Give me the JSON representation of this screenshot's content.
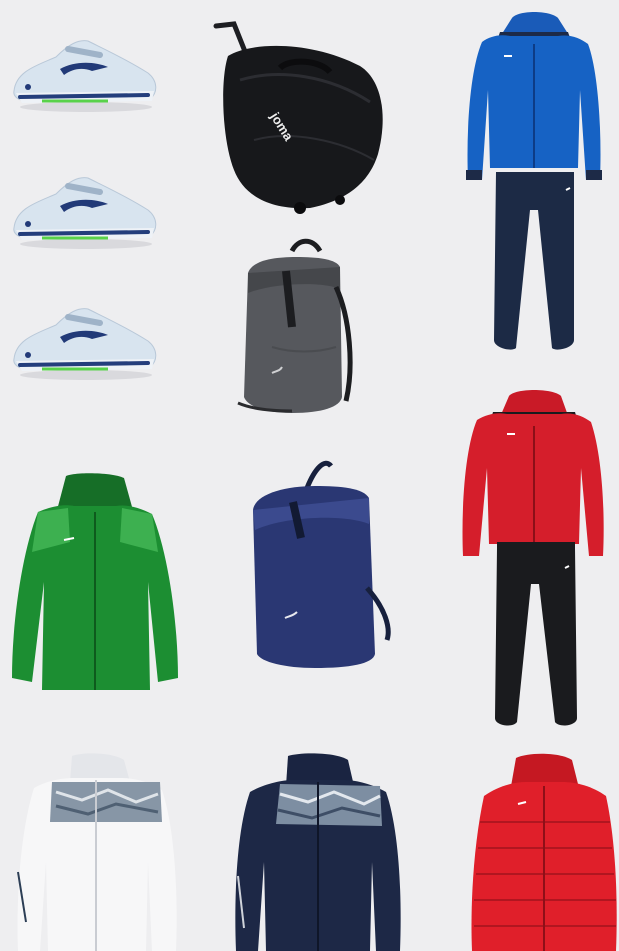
{
  "colors": {
    "background": "#eeeef0",
    "shoe_upper": "#d6e3ee",
    "shoe_accent": "#223a78",
    "shoe_sole_green": "#59d24a",
    "bag_black": "#17181b",
    "backpack_grey": "#56585d",
    "backpack_navy": "#2a3773",
    "tracksuit_blue": "#1662c4",
    "tracksuit_navy": "#1c2a45",
    "tracksuit_red": "#d51e2b",
    "pants_black": "#1a1b1e",
    "jacket_green": "#1c8e32",
    "hoodie_white": "#f7f7f8",
    "hoodie_navy": "#1d2846",
    "puffer_red": "#e01f2a"
  },
  "products": [
    {
      "name": "tennis-shoe",
      "icon": "shoe-icon"
    },
    {
      "name": "tennis-shoe",
      "icon": "shoe-icon"
    },
    {
      "name": "tennis-shoe",
      "icon": "shoe-icon"
    },
    {
      "name": "wheeled-duffel-bag",
      "icon": "trolley-bag-icon",
      "brand_mark": "joma"
    },
    {
      "name": "rolltop-backpack-grey",
      "icon": "backpack-icon"
    },
    {
      "name": "rolltop-backpack-navy",
      "icon": "backpack-icon"
    },
    {
      "name": "tracksuit-blue",
      "icon": "tracksuit-icon"
    },
    {
      "name": "tracksuit-red",
      "icon": "tracksuit-icon"
    },
    {
      "name": "rain-jacket-green",
      "icon": "jacket-icon"
    },
    {
      "name": "hoodie-white",
      "icon": "hoodie-icon"
    },
    {
      "name": "hoodie-navy",
      "icon": "hoodie-icon"
    },
    {
      "name": "puffer-jacket-red",
      "icon": "puffer-icon"
    }
  ]
}
